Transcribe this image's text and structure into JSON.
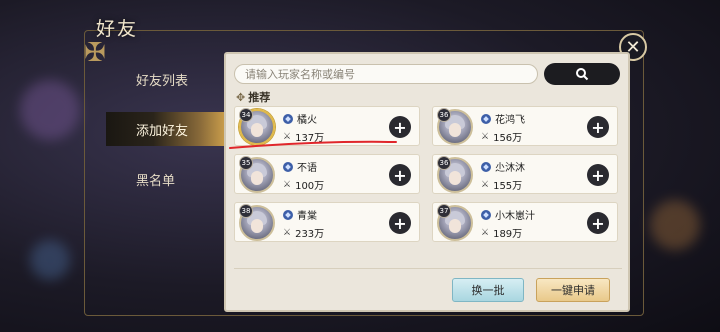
{
  "window": {
    "title": "好友"
  },
  "nav": {
    "items": [
      {
        "label": "好友列表",
        "active": false
      },
      {
        "label": "添加好友",
        "active": true
      },
      {
        "label": "黑名单",
        "active": false
      }
    ]
  },
  "search": {
    "placeholder": "请输入玩家名称或编号",
    "button_icon": "search-icon"
  },
  "section": {
    "label": "推荐"
  },
  "friends": [
    {
      "level": "34",
      "name": "橘火",
      "power": "137万"
    },
    {
      "level": "36",
      "name": "花鸿飞",
      "power": "156万"
    },
    {
      "level": "35",
      "name": "不语",
      "power": "100万"
    },
    {
      "level": "36",
      "name": "尐沐沐",
      "power": "155万"
    },
    {
      "level": "38",
      "name": "青棠",
      "power": "233万"
    },
    {
      "level": "37",
      "name": "小木崽汁",
      "power": "189万"
    }
  ],
  "buttons": {
    "refresh": "换一批",
    "apply_all": "一键申请"
  },
  "colors": {
    "panel_bg": "#ebe6dc",
    "accent_gold": "#c79b4a",
    "annotation_red": "#e0262b"
  }
}
